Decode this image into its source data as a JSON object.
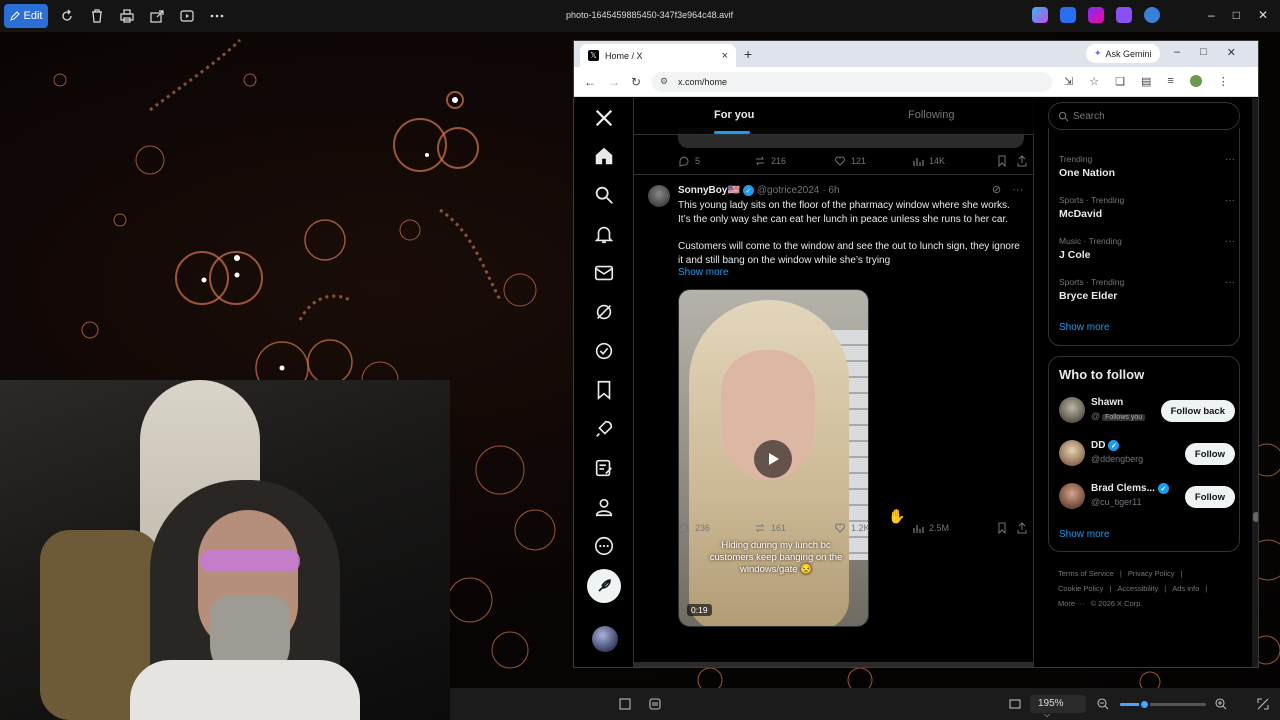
{
  "viewer": {
    "edit_label": "Edit",
    "file_name": "photo-1645459885450-347f3e964c48.avif",
    "zoom": "195%",
    "zoom_level": 0.28
  },
  "browser": {
    "tab_title": "Home / X",
    "ask_gemini": "Ask Gemini",
    "url": "x.com/home"
  },
  "feed": {
    "tab_for_you": "For you",
    "tab_following": "Following",
    "prev_post_actions": {
      "replies": "5",
      "reposts": "216",
      "likes": "121",
      "views": "14K"
    },
    "post": {
      "name": "SonnyBoy🇺🇸",
      "handle": "@gotrice2024",
      "time": "· 6h",
      "text1": "This young lady sits on the floor of the pharmacy window where she works. It’s the only way she can eat her lunch in peace unless she runs to her car.",
      "text2": "Customers will come to the window and see the out to lunch sign, they ignore it and still bang on the window while she’s trying",
      "show_more": "Show more",
      "video_caption": "Hiding during my lunch bc customers keep banging on the windows/gate 😒",
      "video_time": "0:19",
      "actions": {
        "replies": "236",
        "reposts": "161",
        "likes": "1.2K",
        "views": "2.5M"
      }
    }
  },
  "sidebar": {
    "search_placeholder": "Search",
    "trends": [
      {
        "category": "Trending",
        "name": "One Nation"
      },
      {
        "category": "Sports · Trending",
        "name": "McDavid"
      },
      {
        "category": "Music · Trending",
        "name": "J Cole"
      },
      {
        "category": "Sports · Trending",
        "name": "Bryce Elder"
      }
    ],
    "trends_show_more": "Show more",
    "who_to_follow": "Who to follow",
    "follow_users": [
      {
        "name": "Shawn",
        "handle": "@",
        "follows_you": "Follows you",
        "button": "Follow back"
      },
      {
        "name": "DD",
        "handle": "@ddengberg",
        "button": "Follow"
      },
      {
        "name": "Brad Clems...",
        "handle": "@cu_tiger11",
        "button": "Follow"
      }
    ],
    "follow_show_more": "Show more",
    "footer": [
      "Terms of Service",
      "|",
      "Privacy Policy",
      "|",
      "Cookie Policy",
      "|",
      "Accessibility",
      "|",
      "Ads info",
      "|",
      "More ···",
      "© 2026 X Corp."
    ]
  },
  "colors": {
    "accent": "#1d9bf0",
    "viewer_edit": "#2b6fd6"
  }
}
